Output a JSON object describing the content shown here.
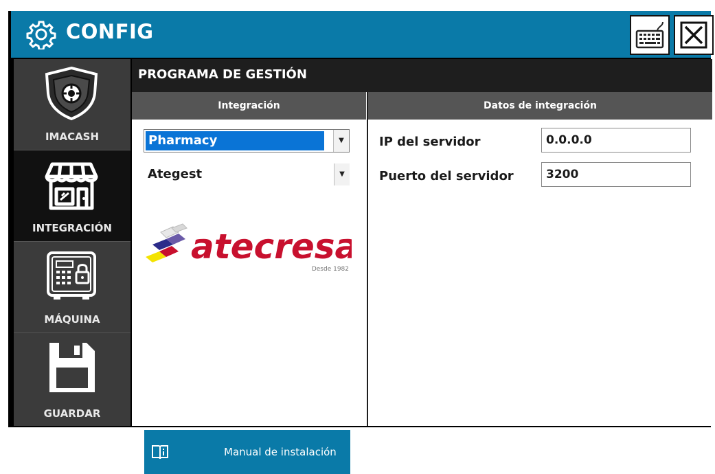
{
  "window": {
    "title": "CONFIG"
  },
  "sidebar": {
    "items": [
      {
        "label": "IMACASH",
        "icon": "shield-icon",
        "active": false
      },
      {
        "label": "INTEGRACIÓN",
        "icon": "store-icon",
        "active": true
      },
      {
        "label": "MÁQUINA",
        "icon": "safe-icon",
        "active": false
      },
      {
        "label": "GUARDAR",
        "icon": "floppy-disk-icon",
        "active": false
      }
    ]
  },
  "main": {
    "title": "PROGRAMA DE GESTIÓN",
    "integration": {
      "header": "Integración",
      "select1_value": "Pharmacy",
      "select2_value": "Ategest",
      "logo": {
        "brand": "atecresa",
        "tagline": "Desde 1982"
      },
      "manual_button_label": "Manual de instalación"
    },
    "data": {
      "header": "Datos de integración",
      "fields": [
        {
          "label": "IP del servidor",
          "value": "0.0.0.0"
        },
        {
          "label": "Puerto del servidor",
          "value": "3200"
        }
      ]
    }
  },
  "colors": {
    "titlebar": "#0a7aa8",
    "sidebar": "#3b3b3b",
    "sidebar_active": "#111111",
    "selected_option": "#0a74d6",
    "logo_red": "#c8102e"
  }
}
